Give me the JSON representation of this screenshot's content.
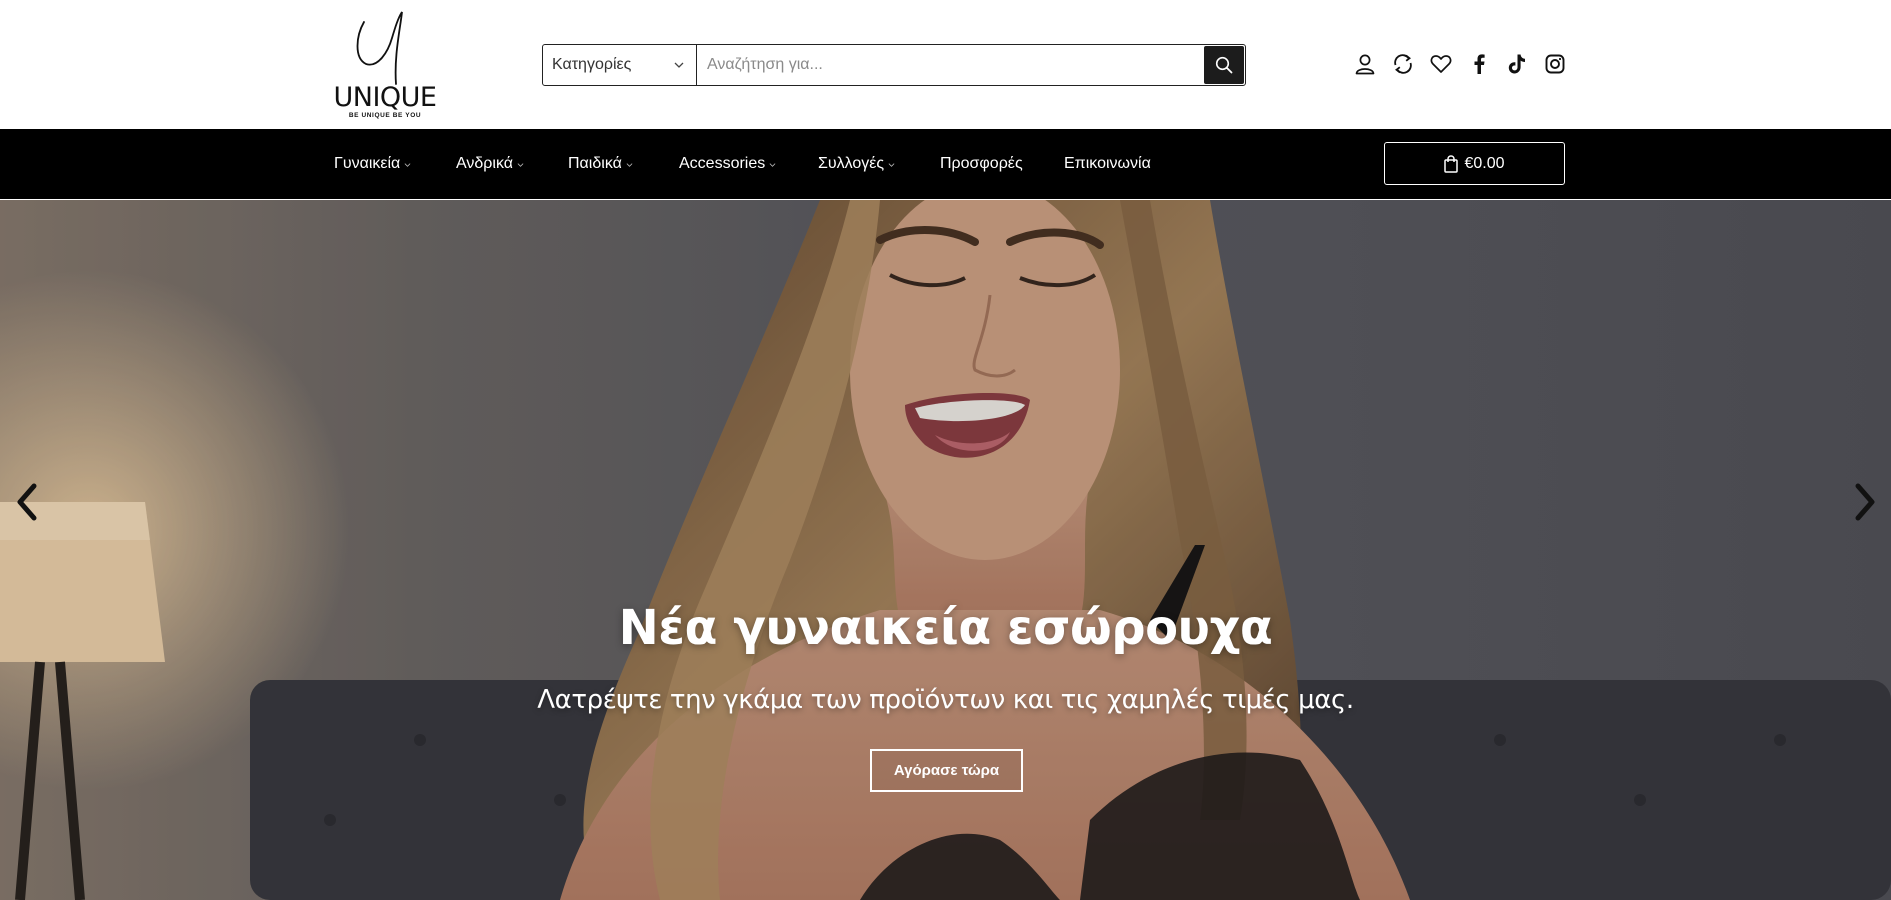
{
  "brand": {
    "logo_letter": "U",
    "name": "UNIQUE",
    "tagline": "BE UNIQUE BE YOU"
  },
  "search": {
    "category_label": "Κατηγορίες",
    "placeholder": "Αναζήτηση για...",
    "button_icon": "search-icon"
  },
  "header_icons": [
    "user-icon",
    "compare-icon",
    "heart-icon",
    "facebook-icon",
    "tiktok-icon",
    "instagram-icon"
  ],
  "nav": {
    "items": [
      {
        "label": "Γυναικεία",
        "dropdown": true
      },
      {
        "label": "Ανδρικά",
        "dropdown": true
      },
      {
        "label": "Παιδικά",
        "dropdown": true
      },
      {
        "label": "Accessories",
        "dropdown": true
      },
      {
        "label": "Συλλογές",
        "dropdown": true
      },
      {
        "label": "Προσφορές",
        "dropdown": false
      },
      {
        "label": "Επικοινωνία",
        "dropdown": false
      }
    ],
    "cart_total": "€0.00",
    "cart_icon": "shopping-bag-icon"
  },
  "hero": {
    "title": "Νέα γυναικεία εσώρουχα",
    "subtitle": "Λατρέψτε την γκάμα των προϊόντων και τις χαμηλές τιμές μας.",
    "cta": "Αγόρασε τώρα",
    "prev_icon": "chevron-left-icon",
    "next_icon": "chevron-right-icon"
  },
  "colors": {
    "nav_background": "#000000",
    "search_button": "#1c1c1c",
    "text_light": "#ffffff"
  }
}
